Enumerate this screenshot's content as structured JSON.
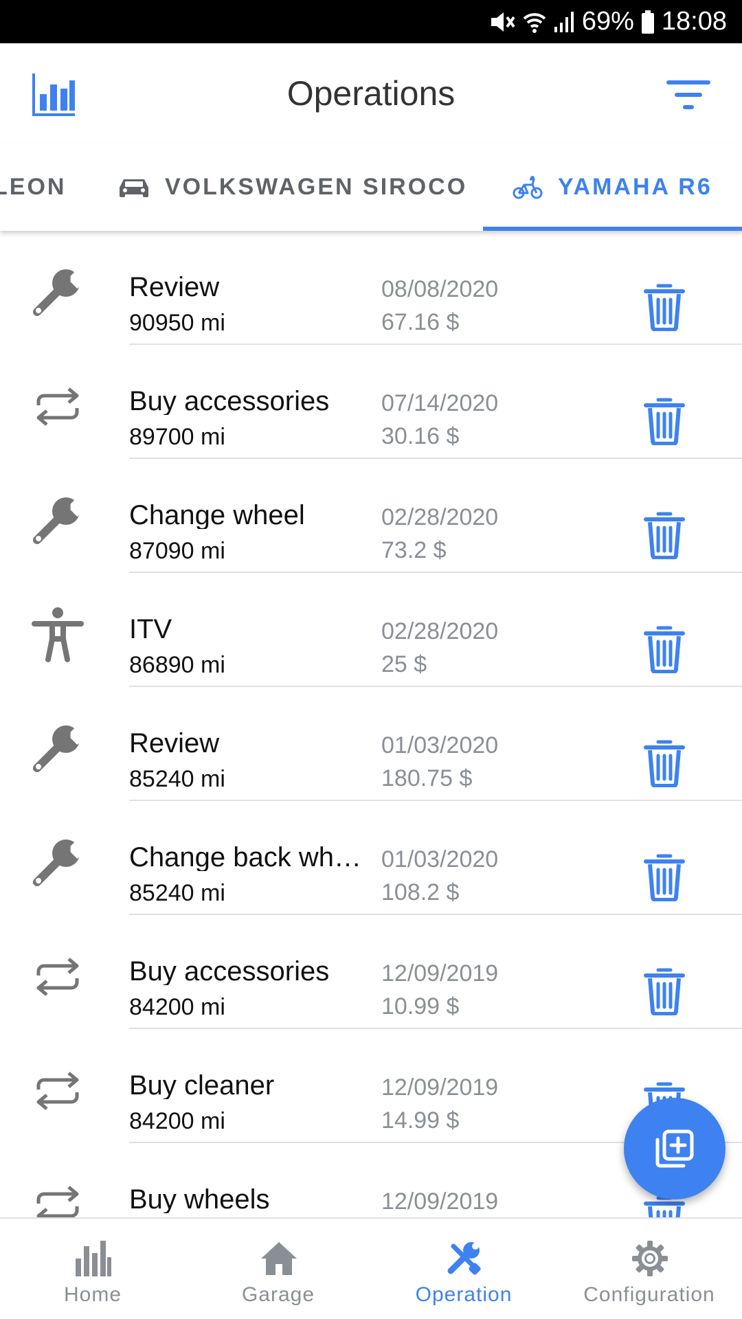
{
  "status_bar": {
    "battery": "69%",
    "time": "18:08"
  },
  "app_bar": {
    "title": "Operations"
  },
  "tabs": [
    {
      "label": "LEON",
      "icon": "car-icon",
      "active": false
    },
    {
      "label": "VOLKSWAGEN SIROCO",
      "icon": "car-icon",
      "active": false
    },
    {
      "label": "YAMAHA R6",
      "icon": "bike-icon",
      "active": true
    }
  ],
  "operations": [
    {
      "icon": "wrench-icon",
      "name": "Review",
      "mileage": "90950 mi",
      "date": "08/08/2020",
      "price": "67.16 $"
    },
    {
      "icon": "swap-icon",
      "name": "Buy accessories",
      "mileage": "89700 mi",
      "date": "07/14/2020",
      "price": "30.16 $"
    },
    {
      "icon": "wrench-icon",
      "name": "Change wheel",
      "mileage": "87090 mi",
      "date": "02/28/2020",
      "price": "73.2 $"
    },
    {
      "icon": "person-icon",
      "name": "ITV",
      "mileage": "86890 mi",
      "date": "02/28/2020",
      "price": "25 $"
    },
    {
      "icon": "wrench-icon",
      "name": "Review",
      "mileage": "85240 mi",
      "date": "01/03/2020",
      "price": "180.75 $"
    },
    {
      "icon": "wrench-icon",
      "name": "Change back wh…",
      "mileage": "85240 mi",
      "date": "01/03/2020",
      "price": "108.2 $"
    },
    {
      "icon": "swap-icon",
      "name": "Buy accessories",
      "mileage": "84200 mi",
      "date": "12/09/2019",
      "price": "10.99 $"
    },
    {
      "icon": "swap-icon",
      "name": "Buy cleaner",
      "mileage": "84200 mi",
      "date": "12/09/2019",
      "price": "14.99 $"
    },
    {
      "icon": "swap-icon",
      "name": "Buy wheels",
      "mileage": "",
      "date": "12/09/2019",
      "price": ""
    }
  ],
  "bottom_nav": [
    {
      "label": "Home",
      "icon": "bar-chart-icon",
      "active": false
    },
    {
      "label": "Garage",
      "icon": "home-icon",
      "active": false
    },
    {
      "label": "Operation",
      "icon": "tools-icon",
      "active": true
    },
    {
      "label": "Configuration",
      "icon": "gear-icon",
      "active": false
    }
  ],
  "colors": {
    "accent": "#3d82f0",
    "icon_gray": "#757575",
    "secondary_text": "#8a8f96"
  }
}
